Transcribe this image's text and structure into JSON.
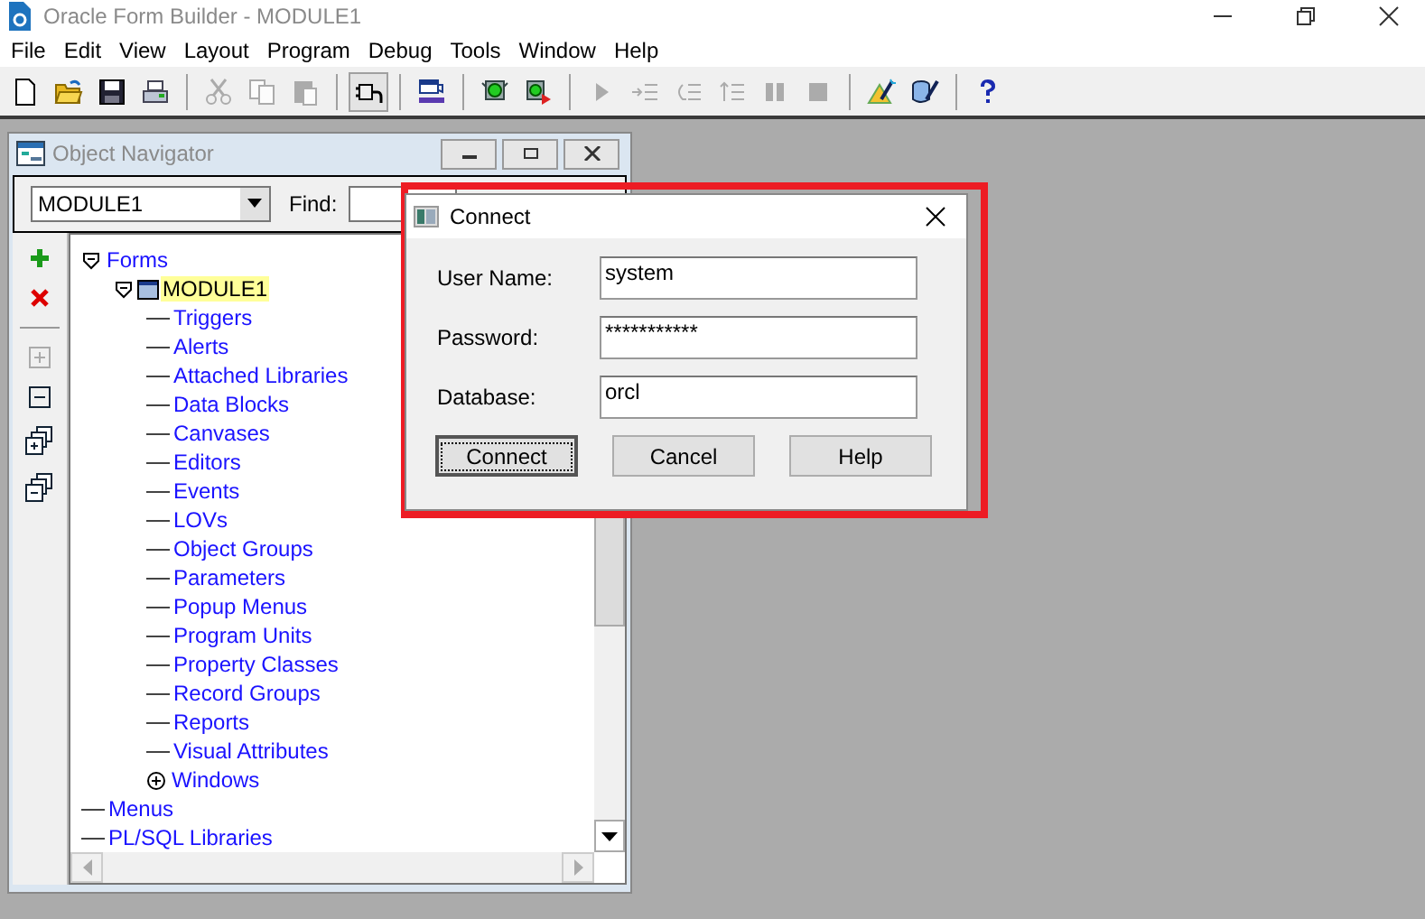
{
  "window": {
    "title": "Oracle Form Builder - MODULE1"
  },
  "menu": [
    "File",
    "Edit",
    "View",
    "Layout",
    "Program",
    "Debug",
    "Tools",
    "Window",
    "Help"
  ],
  "toolbar": [
    [
      {
        "disabled": false
      },
      {
        "disabled": false
      },
      {
        "disabled": false
      },
      {
        "disabled": false
      }
    ],
    [
      {
        "disabled": true
      },
      {
        "disabled": true
      },
      {
        "disabled": true
      }
    ],
    [
      {
        "disabled": false
      }
    ],
    [
      {
        "disabled": false
      }
    ],
    [
      {
        "disabled": false
      },
      {
        "disabled": false
      }
    ],
    [
      {
        "disabled": true
      },
      {
        "disabled": true
      },
      {
        "disabled": true
      },
      {
        "disabled": true
      },
      {
        "disabled": true
      },
      {
        "disabled": true
      }
    ],
    [
      {
        "disabled": false
      },
      {
        "disabled": false
      }
    ],
    [
      {
        "disabled": false
      }
    ]
  ],
  "navigator": {
    "title": "Object Navigator",
    "module": "MODULE1",
    "find_label": "Find:",
    "tree": [
      {
        "label": "Forms",
        "expanded": true,
        "children": [
          {
            "label": "MODULE1",
            "expanded": true,
            "selected": true,
            "children": [
              {
                "label": "Triggers"
              },
              {
                "label": "Alerts"
              },
              {
                "label": "Attached Libraries"
              },
              {
                "label": "Data Blocks"
              },
              {
                "label": "Canvases"
              },
              {
                "label": "Editors"
              },
              {
                "label": "Events"
              },
              {
                "label": "LOVs"
              },
              {
                "label": "Object Groups"
              },
              {
                "label": "Parameters"
              },
              {
                "label": "Popup Menus"
              },
              {
                "label": "Program Units"
              },
              {
                "label": "Property Classes"
              },
              {
                "label": "Record Groups"
              },
              {
                "label": "Reports"
              },
              {
                "label": "Visual Attributes"
              },
              {
                "label": "Windows",
                "expanded": false
              }
            ]
          }
        ]
      },
      {
        "label": "Menus"
      },
      {
        "label": "PL/SQL Libraries"
      }
    ]
  },
  "dialog": {
    "title": "Connect",
    "fields": [
      {
        "label": "User Name:",
        "value": "system"
      },
      {
        "label": "Password:",
        "value": "***********"
      },
      {
        "label": "Database:",
        "value": "orcl"
      }
    ],
    "buttons": [
      {
        "label": "Connect",
        "focused": true
      },
      {
        "label": "Cancel",
        "focused": false
      },
      {
        "label": "Help",
        "focused": false
      }
    ],
    "highlighted": true
  }
}
